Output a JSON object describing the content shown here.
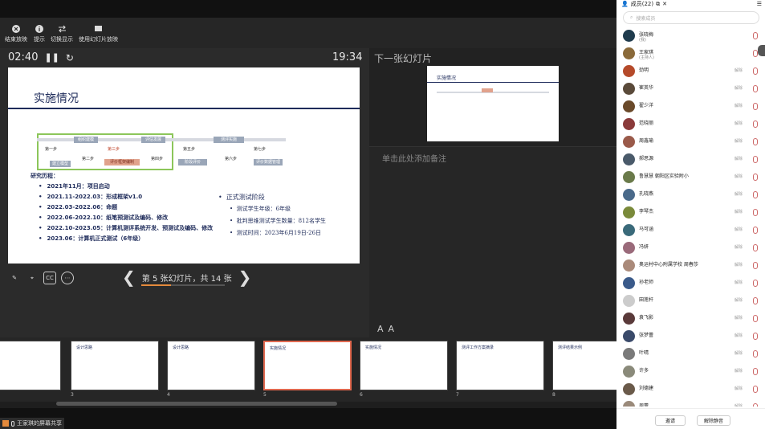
{
  "toolbar": {
    "end_show": "结束放映",
    "hint": "提示",
    "switch_display": "切换显示",
    "use_slideshow": "使用幻灯片放映"
  },
  "presenter": {
    "elapsed": "02:40",
    "clock": "19:34",
    "counter": "第 5 张幻灯片，共 14 张",
    "progress_fraction": 0.36
  },
  "slide": {
    "title": "实施情况",
    "timeline": {
      "steps": [
        "第一步",
        "第二步",
        "第三步",
        "第四步",
        "第五步",
        "第六步",
        "第七步"
      ],
      "boxes": [
        "组织建模",
        "评估发展",
        "建立模型",
        "评价框架编制",
        "阶段评价",
        "测评实施",
        "评价数据管理",
        "数据分析",
        "报告形成"
      ]
    },
    "history_title": "研究历程：",
    "history": [
      "2021年11月：项目启动",
      "2021.11-2022.03：形成框架v1.0",
      "2022.03-2022.06：命题",
      "2022.06-2022.10：纸笔预测试及编码、修改",
      "2022.10-2023.05：计算机测评系统开发、预测试及编码、修改",
      "2023.06：计算机正式测试（6年级）"
    ],
    "formal_title": "正式测试阶段",
    "formal": [
      "测试学生年级：6年级",
      "批判思维测试学生数量：812名学生",
      "测试时间：2023年6月19日-26日"
    ]
  },
  "next_slide": {
    "label": "下一张幻灯片",
    "title": "实施情况"
  },
  "notes": {
    "placeholder": "单击此处添加备注"
  },
  "zoom": {
    "increase": "A",
    "decrease": "A"
  },
  "thumbnails": [
    {
      "num": "",
      "title": ""
    },
    {
      "num": "3",
      "title": "设计思路"
    },
    {
      "num": "4",
      "title": "设计思路"
    },
    {
      "num": "5",
      "title": "实施情况"
    },
    {
      "num": "6",
      "title": "实施情况"
    },
    {
      "num": "7",
      "title": "测评工作方案摘录"
    },
    {
      "num": "8",
      "title": "测评结果示例"
    }
  ],
  "share_status": "王家琪的屏幕共享",
  "panel": {
    "title": "成员(22)",
    "search_placeholder": "搜索成员",
    "unmute_label": "解除",
    "members": [
      {
        "name": "张晓梅",
        "sub": "(我)",
        "color": "#1f3b4d"
      },
      {
        "name": "王家琪",
        "sub": "(主持人)",
        "color": "#8a6a3a"
      },
      {
        "name": "劲明",
        "sub": "",
        "color": "#b54a2a"
      },
      {
        "name": "崔英华",
        "sub": "",
        "color": "#5a4a3a"
      },
      {
        "name": "翟少洋",
        "sub": "",
        "color": "#6a4a2a"
      },
      {
        "name": "范晓丽",
        "sub": "",
        "color": "#8a3a3a"
      },
      {
        "name": "周鑫瑜",
        "sub": "",
        "color": "#9a5a4a"
      },
      {
        "name": "郝思源",
        "sub": "",
        "color": "#4a5a6a"
      },
      {
        "name": "鲁慧慧 朝阳区实验附小",
        "sub": "",
        "color": "#6a7a4a"
      },
      {
        "name": "孔晓燕",
        "sub": "",
        "color": "#4a6a8a"
      },
      {
        "name": "李琴杰",
        "sub": "",
        "color": "#7a8a3a"
      },
      {
        "name": "马可涵",
        "sub": "",
        "color": "#3a6a7a"
      },
      {
        "name": "冯妍",
        "sub": "",
        "color": "#9a6a7a"
      },
      {
        "name": "奥运村中心附属学校 周春莎",
        "sub": "",
        "color": "#aa8a7a"
      },
      {
        "name": "孙老师",
        "sub": "",
        "color": "#3a5a8a"
      },
      {
        "name": "田莲杆",
        "sub": "",
        "color": "#cccccc"
      },
      {
        "name": "袁飞影",
        "sub": "",
        "color": "#5a3a3a"
      },
      {
        "name": "张梦蕾",
        "sub": "",
        "color": "#3a4a6a"
      },
      {
        "name": "叶晴",
        "sub": "",
        "color": "#7a7a7a"
      },
      {
        "name": "许多",
        "sub": "",
        "color": "#8a8a7a"
      },
      {
        "name": "刘德建",
        "sub": "",
        "color": "#6a5a4a"
      },
      {
        "name": "周蕾",
        "sub": "",
        "color": "#9a8a7a"
      }
    ],
    "invite": "邀请",
    "unmute_all": "解除静音"
  },
  "colors": {
    "accent": "#e0684f",
    "slide_navy": "#1e2b5a"
  }
}
